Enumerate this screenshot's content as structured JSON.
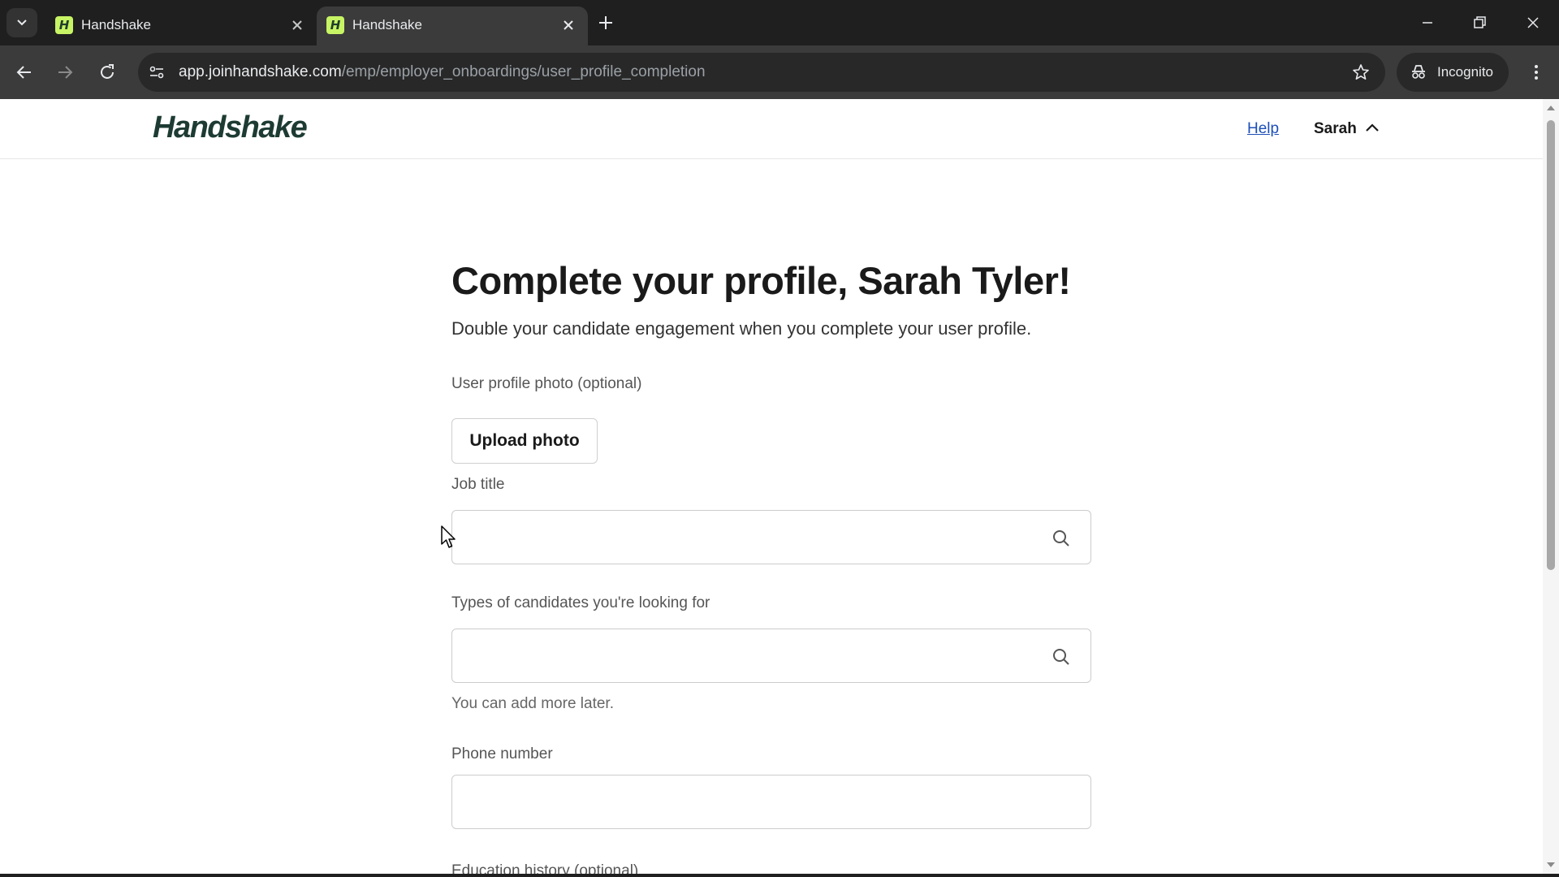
{
  "browser": {
    "tabs": [
      {
        "title": "Handshake",
        "active": false
      },
      {
        "title": "Handshake",
        "active": true
      }
    ],
    "favicon_letter": "H",
    "url_host": "app.joinhandshake.com",
    "url_path": "/emp/employer_onboardings/user_profile_completion",
    "incognito_label": "Incognito"
  },
  "header": {
    "logo": "Handshake",
    "help": "Help",
    "user_name": "Sarah"
  },
  "form": {
    "title": "Complete your profile, Sarah Tyler!",
    "subtitle": "Double your candidate engagement when you complete your user profile.",
    "photo_label": "User profile photo (optional)",
    "upload_button": "Upload photo",
    "job_title_label": "Job title",
    "job_title_value": "",
    "candidate_types_label": "Types of candidates you're looking for",
    "candidate_types_value": "",
    "candidate_types_helper": "You can add more later.",
    "phone_label": "Phone number",
    "phone_value": "",
    "education_label": "Education history (optional)"
  },
  "colors": {
    "brand_dark": "#1d3b33",
    "brand_accent": "#c7f464",
    "link": "#1c4fb8"
  },
  "icons": [
    "tab-search-icon",
    "close-icon",
    "plus-icon",
    "minimize-icon",
    "restore-icon",
    "back-icon",
    "forward-icon",
    "reload-icon",
    "site-info-icon",
    "star-icon",
    "incognito-icon",
    "more-icon",
    "chevron-up-icon",
    "search-icon"
  ]
}
